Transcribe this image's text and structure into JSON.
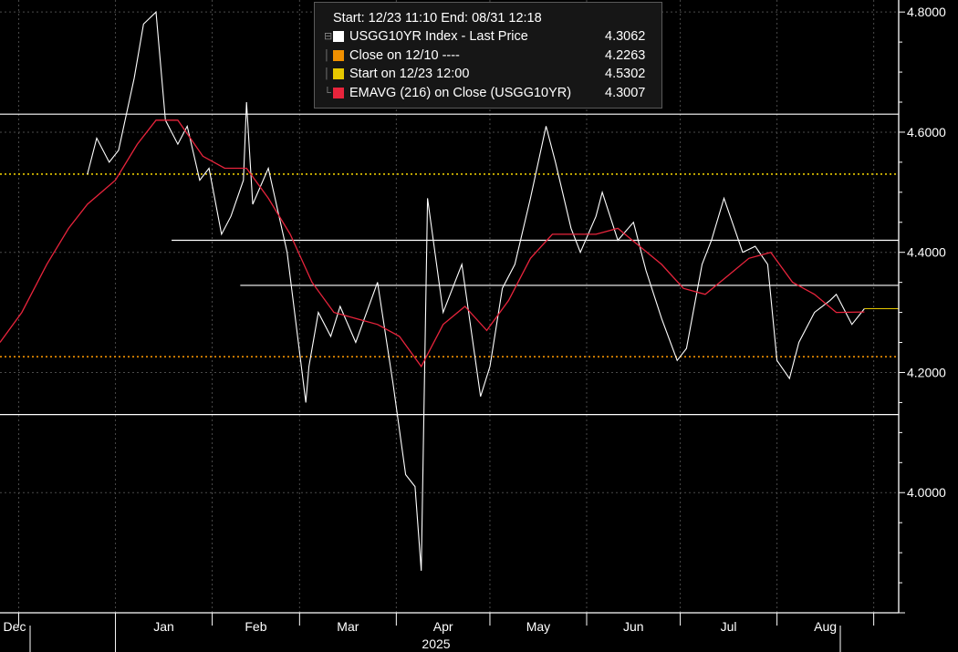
{
  "chart_data": {
    "type": "line",
    "header": {
      "start_label": "Start: 12/23 11:10",
      "end_label": "End: 08/31 12:18"
    },
    "legend": [
      {
        "label": "USGG10YR Index - Last Price",
        "value": "4.3062",
        "color": "#ffffff"
      },
      {
        "label": "Close on 12/10 ----",
        "value": "4.2263",
        "color": "#f09000"
      },
      {
        "label": "Start on 12/23 12:00",
        "value": "4.5302",
        "color": "#e6c800"
      },
      {
        "label": "EMAVG (216)  on Close (USGG10YR)",
        "value": "4.3007",
        "color": "#e8243c"
      }
    ],
    "ylim": [
      3.8,
      4.82
    ],
    "y_ticks": [
      "4.8000",
      "4.6000",
      "4.4000",
      "4.2000",
      "4.0000"
    ],
    "x_tick_labels": [
      "Dec",
      "Jan",
      "Feb",
      "Mar",
      "Apr",
      "May",
      "Jun",
      "Jul",
      "Aug"
    ],
    "x_year_label": "2025",
    "last_value": 4.3062,
    "series": [
      {
        "name": "USGG10YR Index - Last Price",
        "color": "#ffffff",
        "x": [
          "2024-12-23",
          "2024-12-26",
          "2024-12-30",
          "2025-01-02",
          "2025-01-07",
          "2025-01-10",
          "2025-01-14",
          "2025-01-17",
          "2025-01-21",
          "2025-01-24",
          "2025-01-28",
          "2025-01-31",
          "2025-02-04",
          "2025-02-07",
          "2025-02-11",
          "2025-02-12",
          "2025-02-14",
          "2025-02-19",
          "2025-02-25",
          "2025-03-03",
          "2025-03-04",
          "2025-03-07",
          "2025-03-11",
          "2025-03-14",
          "2025-03-19",
          "2025-03-26",
          "2025-03-31",
          "2025-04-04",
          "2025-04-07",
          "2025-04-09",
          "2025-04-11",
          "2025-04-16",
          "2025-04-22",
          "2025-04-28",
          "2025-05-01",
          "2025-05-05",
          "2025-05-09",
          "2025-05-14",
          "2025-05-19",
          "2025-05-22",
          "2025-05-27",
          "2025-05-30",
          "2025-06-04",
          "2025-06-06",
          "2025-06-11",
          "2025-06-16",
          "2025-06-20",
          "2025-06-25",
          "2025-06-30",
          "2025-07-03",
          "2025-07-08",
          "2025-07-11",
          "2025-07-15",
          "2025-07-21",
          "2025-07-25",
          "2025-07-29",
          "2025-08-01",
          "2025-08-05",
          "2025-08-08",
          "2025-08-13",
          "2025-08-18",
          "2025-08-20",
          "2025-08-25",
          "2025-08-29"
        ],
        "values": [
          4.53,
          4.59,
          4.55,
          4.57,
          4.69,
          4.78,
          4.8,
          4.62,
          4.58,
          4.61,
          4.52,
          4.54,
          4.43,
          4.46,
          4.52,
          4.65,
          4.48,
          4.54,
          4.4,
          4.15,
          4.21,
          4.3,
          4.26,
          4.31,
          4.25,
          4.35,
          4.18,
          4.03,
          4.01,
          3.87,
          4.49,
          4.3,
          4.38,
          4.16,
          4.21,
          4.34,
          4.38,
          4.49,
          4.61,
          4.55,
          4.44,
          4.4,
          4.46,
          4.5,
          4.42,
          4.45,
          4.37,
          4.29,
          4.22,
          4.24,
          4.38,
          4.42,
          4.49,
          4.4,
          4.41,
          4.38,
          4.22,
          4.19,
          4.25,
          4.3,
          4.32,
          4.33,
          4.28,
          4.3062
        ]
      },
      {
        "name": "EMAVG (216)  on Close (USGG10YR)",
        "color": "#e8243c",
        "x": [
          "2024-11-25",
          "2024-12-02",
          "2024-12-10",
          "2024-12-17",
          "2024-12-23",
          "2025-01-01",
          "2025-01-08",
          "2025-01-14",
          "2025-01-21",
          "2025-01-29",
          "2025-02-05",
          "2025-02-12",
          "2025-02-19",
          "2025-02-26",
          "2025-03-05",
          "2025-03-12",
          "2025-03-19",
          "2025-03-26",
          "2025-04-02",
          "2025-04-09",
          "2025-04-16",
          "2025-04-23",
          "2025-04-30",
          "2025-05-07",
          "2025-05-14",
          "2025-05-21",
          "2025-05-28",
          "2025-06-04",
          "2025-06-11",
          "2025-06-18",
          "2025-06-25",
          "2025-07-02",
          "2025-07-09",
          "2025-07-16",
          "2025-07-23",
          "2025-07-30",
          "2025-08-06",
          "2025-08-13",
          "2025-08-20",
          "2025-08-29"
        ],
        "values": [
          4.25,
          4.3,
          4.38,
          4.44,
          4.48,
          4.52,
          4.58,
          4.62,
          4.62,
          4.56,
          4.54,
          4.54,
          4.49,
          4.43,
          4.35,
          4.3,
          4.29,
          4.28,
          4.26,
          4.21,
          4.28,
          4.31,
          4.27,
          4.32,
          4.39,
          4.43,
          4.43,
          4.43,
          4.44,
          4.41,
          4.38,
          4.34,
          4.33,
          4.36,
          4.39,
          4.4,
          4.35,
          4.33,
          4.3,
          4.3007
        ]
      }
    ],
    "reference_lines": [
      {
        "label": "Start on 12/23 12:00",
        "value": 4.5302,
        "color": "#e6c800",
        "style": "dotted"
      },
      {
        "label": "Close on 12/10",
        "value": 4.2263,
        "color": "#f09000",
        "style": "dotted"
      }
    ],
    "horizontal_levels": [
      {
        "value": 4.63,
        "from": "2024-11-25"
      },
      {
        "value": 4.42,
        "from": "2025-01-19"
      },
      {
        "value": 4.345,
        "from": "2025-02-10"
      },
      {
        "value": 4.13,
        "from": "2024-11-25"
      }
    ]
  }
}
